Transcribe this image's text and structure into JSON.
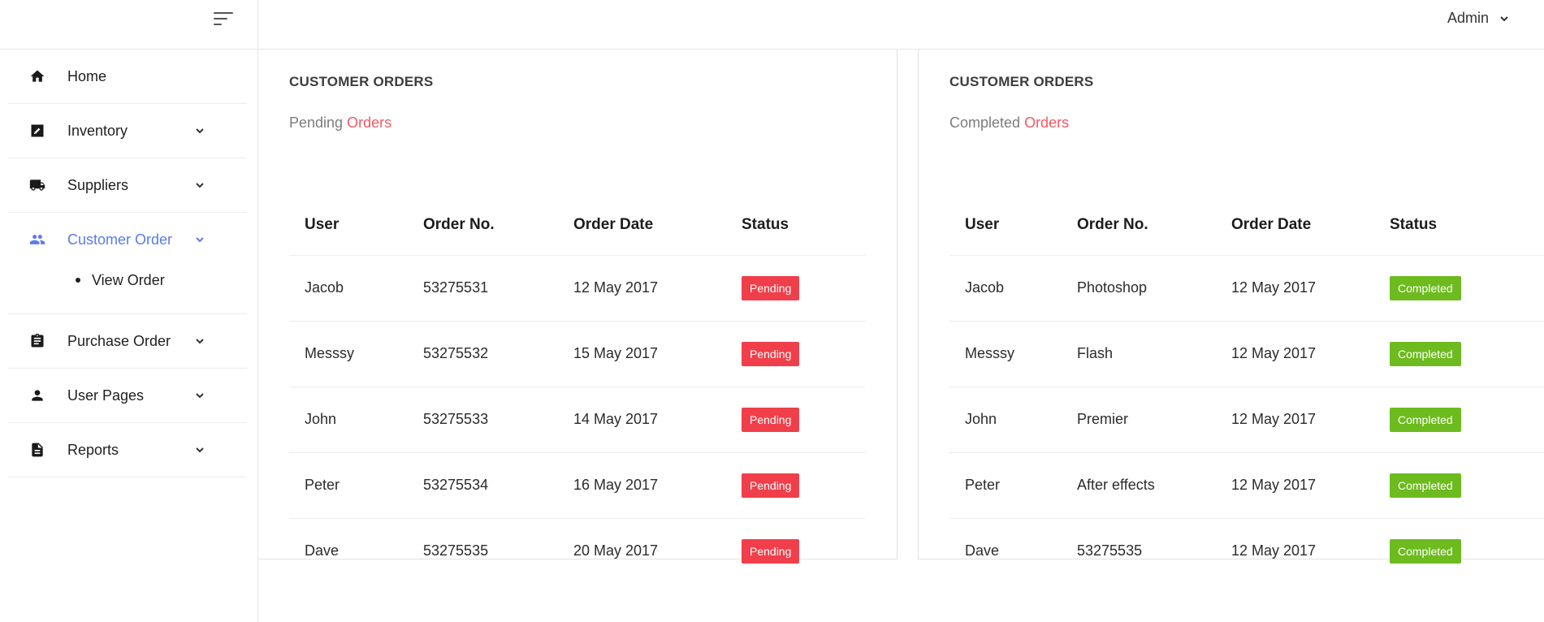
{
  "header": {
    "user_name": "Admin"
  },
  "sidebar": {
    "items": [
      {
        "label": "Home",
        "icon": "home-icon"
      },
      {
        "label": "Inventory",
        "icon": "edit-icon"
      },
      {
        "label": "Suppliers",
        "icon": "truck-icon"
      },
      {
        "label": "Customer Order",
        "icon": "people-icon",
        "active": true,
        "sub": [
          {
            "label": "View Order"
          }
        ]
      },
      {
        "label": "Purchase Order",
        "icon": "clipboard-icon"
      },
      {
        "label": "User Pages",
        "icon": "person-icon"
      },
      {
        "label": "Reports",
        "icon": "document-icon"
      }
    ]
  },
  "colors": {
    "active": "#5b7be9",
    "accent": "#f25961",
    "pending": "#f03f4a",
    "completed": "#6dbb1e"
  },
  "pending_card": {
    "title": "CUSTOMER ORDERS",
    "sub_prefix": "Pending",
    "sub_accent": "Orders",
    "columns": [
      "User",
      "Order No.",
      "Order Date",
      "Status"
    ],
    "rows": [
      {
        "user": "Jacob",
        "order_no": "53275531",
        "date": "12 May 2017",
        "status": "Pending"
      },
      {
        "user": "Messsy",
        "order_no": "53275532",
        "date": "15 May 2017",
        "status": "Pending"
      },
      {
        "user": "John",
        "order_no": "53275533",
        "date": "14 May 2017",
        "status": "Pending"
      },
      {
        "user": "Peter",
        "order_no": "53275534",
        "date": "16 May 2017",
        "status": "Pending"
      },
      {
        "user": "Dave",
        "order_no": "53275535",
        "date": "20 May 2017",
        "status": "Pending"
      }
    ]
  },
  "completed_card": {
    "title": "CUSTOMER ORDERS",
    "sub_prefix": "Completed",
    "sub_accent": "Orders",
    "columns": [
      "User",
      "Order No.",
      "Order Date",
      "Status"
    ],
    "rows": [
      {
        "user": "Jacob",
        "order_no": "Photoshop",
        "date": "12 May 2017",
        "status": "Completed"
      },
      {
        "user": "Messsy",
        "order_no": "Flash",
        "date": "12 May 2017",
        "status": "Completed"
      },
      {
        "user": "John",
        "order_no": "Premier",
        "date": "12 May 2017",
        "status": "Completed"
      },
      {
        "user": "Peter",
        "order_no": "After effects",
        "date": "12 May 2017",
        "status": "Completed"
      },
      {
        "user": "Dave",
        "order_no": "53275535",
        "date": "12 May 2017",
        "status": "Completed"
      }
    ]
  }
}
